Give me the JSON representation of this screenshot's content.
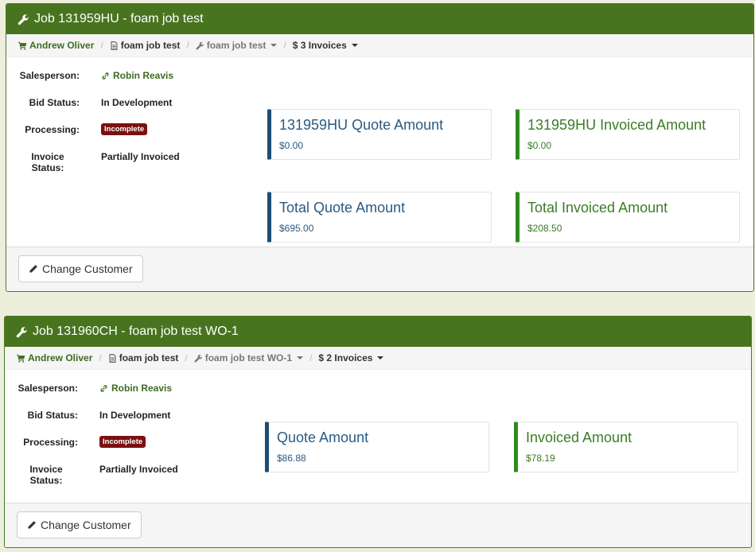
{
  "jobs": [
    {
      "title": "Job 131959HU - foam job test",
      "breadcrumb": {
        "customer": "Andrew Oliver",
        "job_doc": "foam job test",
        "job_menu": "foam job test",
        "invoices": "$ 3 Invoices"
      },
      "fields": {
        "salesperson_label": "Salesperson:",
        "salesperson": "Robin Reavis",
        "bid_status_label": "Bid Status:",
        "bid_status": "In Development",
        "processing_label": "Processing:",
        "processing": "Incomplete",
        "invoice_status_label_1": "Invoice",
        "invoice_status_label_2": "Status:",
        "invoice_status": "Partially Invoiced"
      },
      "cards": [
        {
          "title": "131959HU Quote Amount",
          "value": "$0.00"
        },
        {
          "title": "131959HU Invoiced Amount",
          "value": "$0.00"
        },
        {
          "title": "Total Quote Amount",
          "value": "$695.00"
        },
        {
          "title": "Total Invoiced Amount",
          "value": "$208.50"
        }
      ],
      "change_customer": "Change Customer"
    },
    {
      "title": "Job 131960CH - foam job test WO-1",
      "breadcrumb": {
        "customer": "Andrew Oliver",
        "job_doc": "foam job test",
        "job_menu": "foam job test WO-1",
        "invoices": "$ 2 Invoices"
      },
      "fields": {
        "salesperson_label": "Salesperson:",
        "salesperson": "Robin Reavis",
        "bid_status_label": "Bid Status:",
        "bid_status": "In Development",
        "processing_label": "Processing:",
        "processing": "Incomplete",
        "invoice_status_label_1": "Invoice",
        "invoice_status_label_2": "Status:",
        "invoice_status": "Partially Invoiced"
      },
      "cards": [
        {
          "title": "Quote Amount",
          "value": "$86.88"
        },
        {
          "title": "Invoiced Amount",
          "value": "$78.19"
        }
      ],
      "change_customer": "Change Customer"
    }
  ],
  "colors": {
    "header_green": "#48741f",
    "quote_blue": "#1e4d73",
    "invoice_green": "#2f8a1c",
    "badge_red": "#7a1010"
  },
  "icons": [
    "wrench-icon",
    "cart-icon",
    "document-icon",
    "link-icon",
    "pencil-icon",
    "caret-down-icon"
  ]
}
